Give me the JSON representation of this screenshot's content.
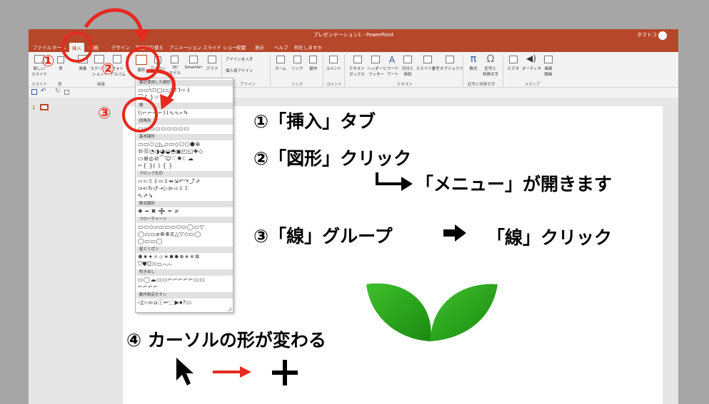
{
  "window": {
    "title": "プレゼンテーション1 - PowerPoint",
    "user": "タマトコ"
  },
  "tabs": [
    "ファイル",
    "ホーム",
    "挿入",
    "描画",
    "デザイン",
    "画面切り替え",
    "アニメーション",
    "スライド ショー",
    "校閲",
    "表示",
    "ヘルプ",
    "何をしますか"
  ],
  "ribbon": {
    "buttons": {
      "new_slide": "新しい\nスライド",
      "table": "表",
      "images": "画像",
      "screenshot": "スクリーン\nショット",
      "album": "フォト\nアルバム",
      "shapes": "図形",
      "icons": "アイコン",
      "models_3d": "3D\nモデル",
      "smartart": "SmartArt",
      "chart": "グラフ",
      "get_addins": "アドインを入手",
      "my_addins": "個人用アドイン",
      "zoom": "ズーム",
      "link": "リンク",
      "action": "動作",
      "comment": "コメント",
      "textbox": "テキスト\nボックス",
      "header_footer": "ヘッダーと\nフッター",
      "wordart": "ワード\nアート",
      "datetime": "日付と\n時刻",
      "slide_number": "スライド番号",
      "object": "オブジェクト",
      "equation": "数式",
      "symbol": "記号と\n特殊文字",
      "video": "ビデオ",
      "audio": "オーディオ",
      "screen_recording": "画面\n録画"
    },
    "groups": [
      "スライド",
      "表",
      "画像",
      "アドイン",
      "リンク",
      "コメント",
      "テキスト",
      "記号と特殊文字",
      "メディア"
    ]
  },
  "thumbnails": {
    "slide_number": "1"
  },
  "shapes_menu": {
    "sections": [
      "最近使用した図形",
      "線",
      "四角形",
      "基本図形",
      "ブロック矢印",
      "数式図形",
      "フローチャート",
      "星とリボン",
      "吹き出し",
      "動作設定ボタン"
    ],
    "rows": {
      "recent": "▭▭\\⬭□▭△ᒣᒣ⇨⇩",
      "recent2": "⌒{ }☆",
      "lines": "\\\\⌐⌐⌐⌐⌇⌇∿∿⌁✎",
      "rect": "▭▭▭▭▭▭▭▭▭",
      "basic1": "▭▭⬭△◺▱▭◇⬠⬡⬢⊕",
      "basic2": "⑩⑫◔◑◕◒◓▣◰◱✚◇",
      "basic3": "▭⊞◎⊘⌒☺♡✺☾☁",
      "basic4": "⌐{ }( ) { }",
      "arrows1": "⇨⇦⇧⇩⬄⇳⇹⇲↶↷⤴⇗",
      "arrows2": "⇒⇐↻↺⇢▷⊳⇨⇩⇧",
      "arrows3": "⇖⇗⇘",
      "eq": "✚ ━ ✖ ➗ ═ ≠",
      "flow1": "▭▭◇▱▭▭▭⬭▭◯▭▽",
      "flow2": "◯▭▭⌀⊗⊕⧖△▽◇▭◯",
      "flow3": "◯▭▭◯",
      "stars1": "✺✷✦✧☆✶✹✸✵✴✳✲",
      "stars2": "⛉⛊⛋⛌▭⌒⌒",
      "callout1": "▭◯☁▭▭⌐⌐⌐⌐⌐▭▭",
      "callout2": "⌐⌐⌐⌐",
      "action": "◁▷◃▹⌂ⓘ↩⬚▶⏹?▭"
    }
  },
  "annotations": {
    "n1": "①",
    "n2": "②",
    "n3": "③",
    "step1": "①「挿入」タブ",
    "step2": "②「図形」クリック",
    "step2b": "「メニュー」が開きます",
    "step3": "③「線」グループ",
    "step3b": "「線」クリック",
    "step4": "④ カーソルの形が変わる",
    "arrow_right": "⮕"
  },
  "colors": {
    "accent": "#b7472a",
    "annotation": "#e52a1f",
    "leaf": "#2a9d1a"
  }
}
